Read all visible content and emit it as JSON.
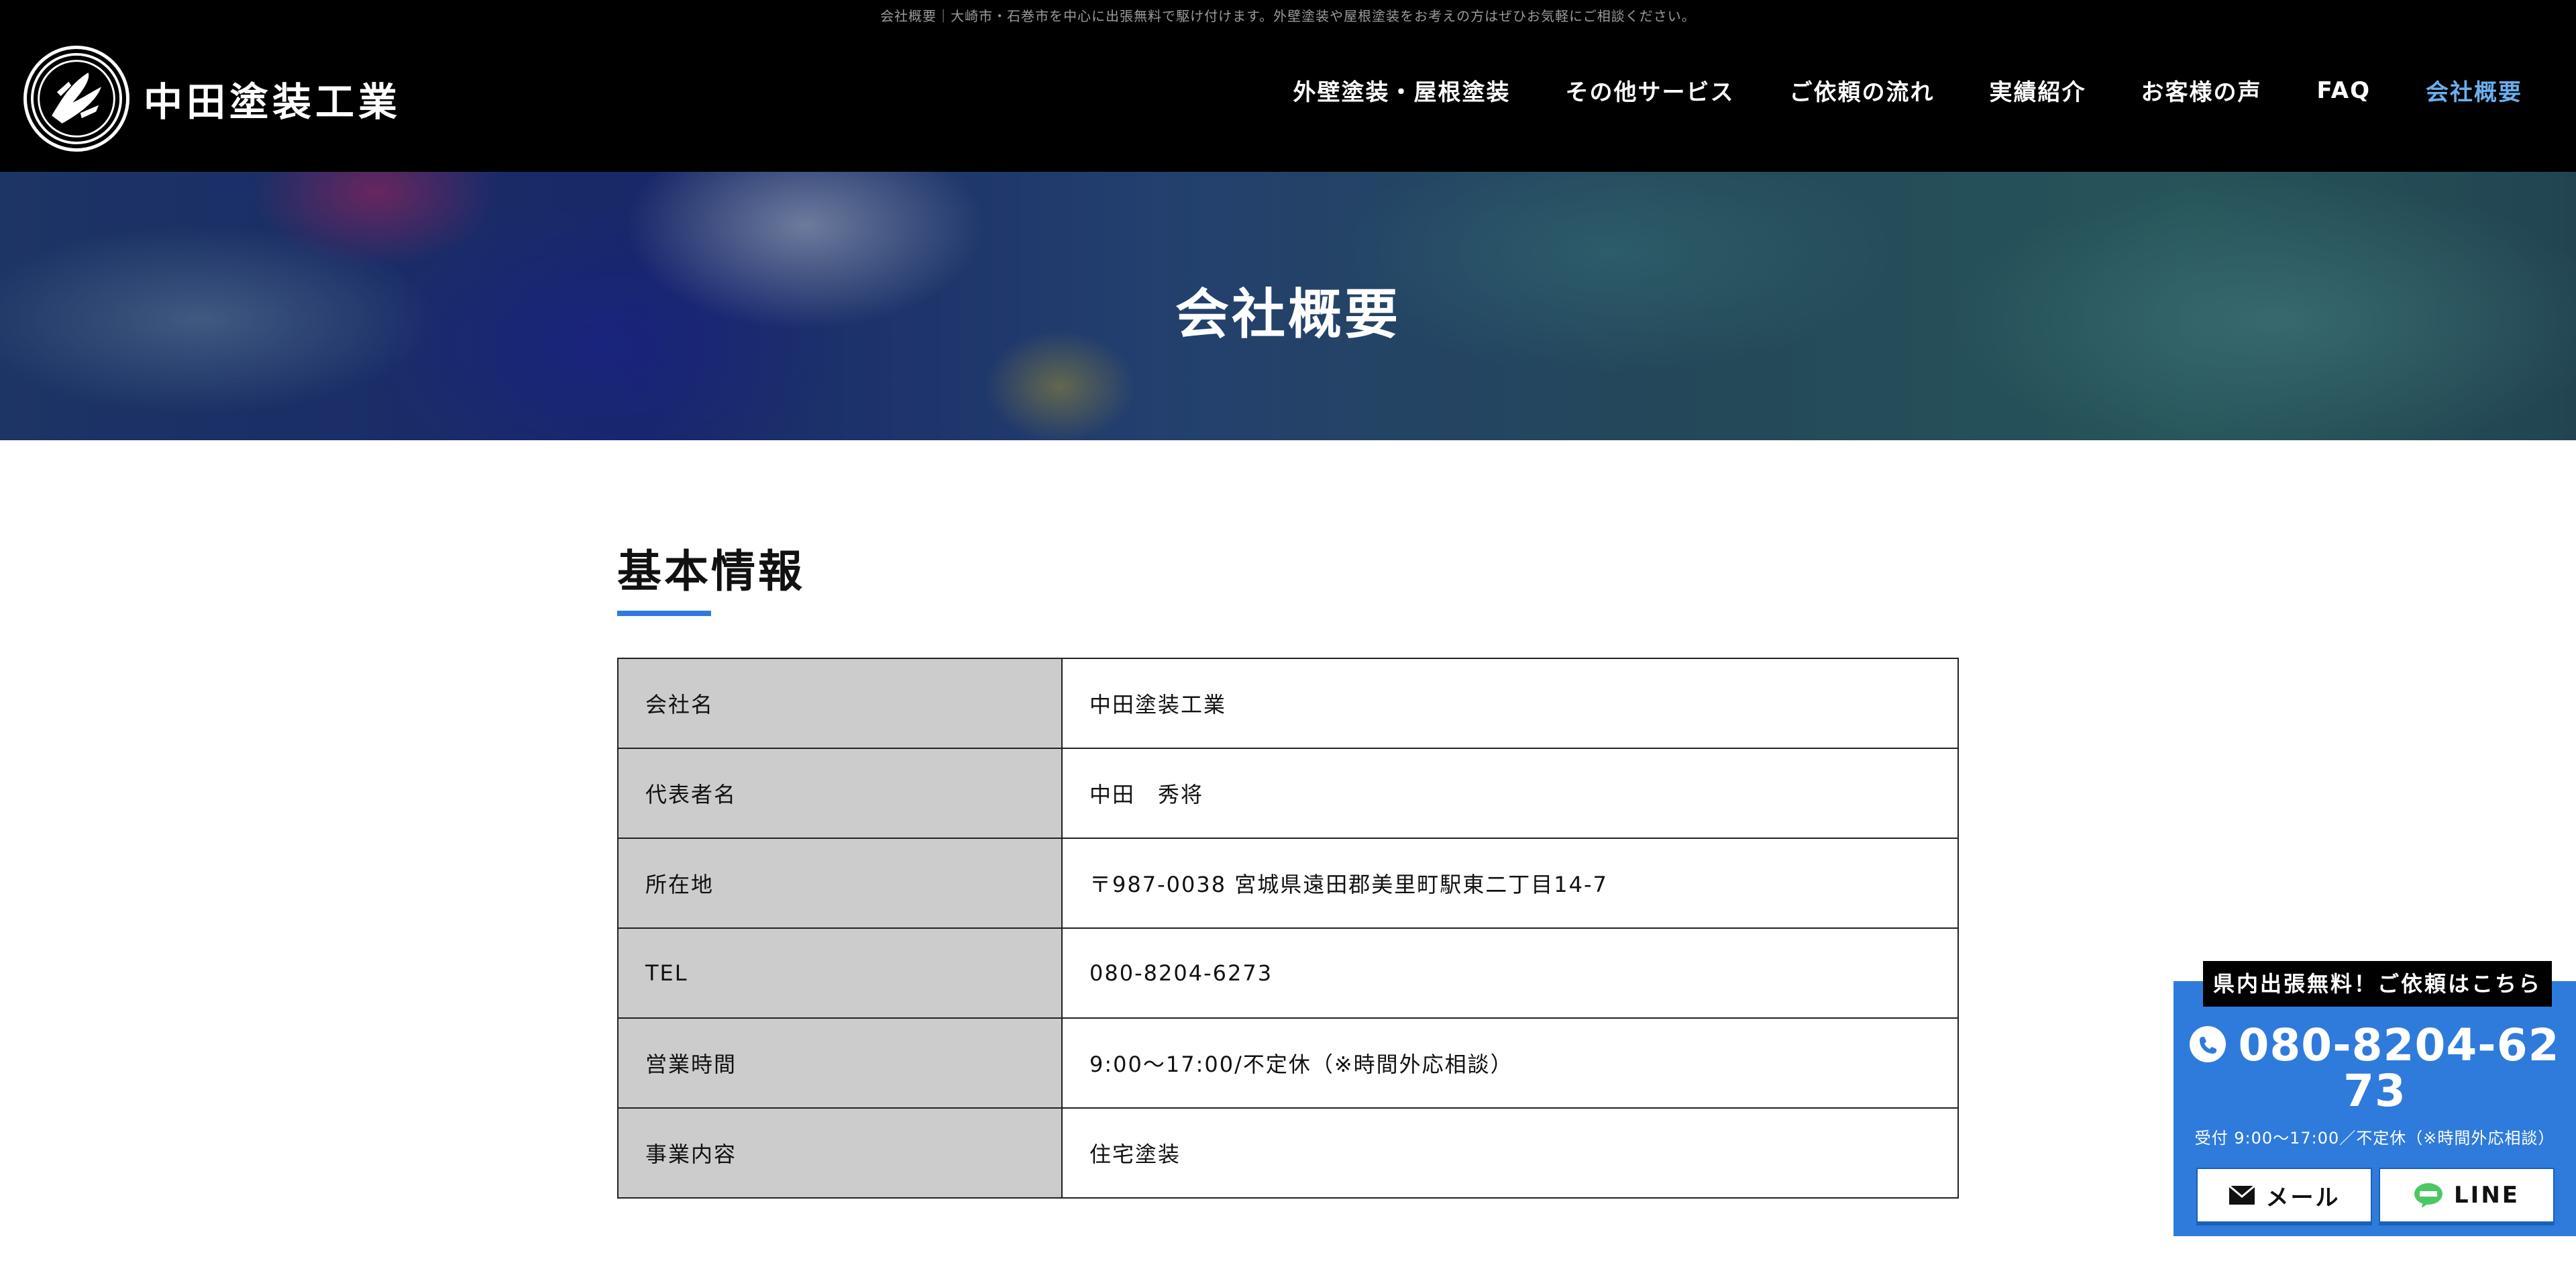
{
  "header": {
    "tagline": "会社概要｜大崎市・石巻市を中心に出張無料で駆け付けます。外壁塗装や屋根塗装をお考えの方はぜひお気軽にご相談ください。",
    "logo_text": "中田塗装工業",
    "nav": [
      {
        "label": "外壁塗装・屋根塗装",
        "active": false
      },
      {
        "label": "その他サービス",
        "active": false
      },
      {
        "label": "ご依頼の流れ",
        "active": false
      },
      {
        "label": "実績紹介",
        "active": false
      },
      {
        "label": "お客様の声",
        "active": false
      },
      {
        "label": "FAQ",
        "active": false
      },
      {
        "label": "会社概要",
        "active": true
      }
    ],
    "active_color": "#6ab0ee"
  },
  "hero": {
    "title": "会社概要"
  },
  "section": {
    "heading": "基本情報",
    "accent_color": "#2f7bdc",
    "rows": [
      {
        "label": "会社名",
        "value": "中田塗装工業"
      },
      {
        "label": "代表者名",
        "value": "中田　秀将"
      },
      {
        "label": "所在地",
        "value": "〒987-0038 宮城県遠田郡美里町駅東二丁目14-7"
      },
      {
        "label": "TEL",
        "value": "080-8204-6273"
      },
      {
        "label": "営業時間",
        "value": "9:00〜17:00/不定休（※時間外応相談）"
      },
      {
        "label": "事業内容",
        "value": "住宅塗装"
      }
    ]
  },
  "contact_widget": {
    "badge": "県内出張無料！ご依頼はこちら",
    "phone_line1": "080-8204-62",
    "phone_line2": "73",
    "hours": "受付 9:00〜17:00／不定休（※時間外応相談）",
    "mail_label": "メール",
    "line_label": "LINE",
    "background_color": "#2f7bdc"
  }
}
